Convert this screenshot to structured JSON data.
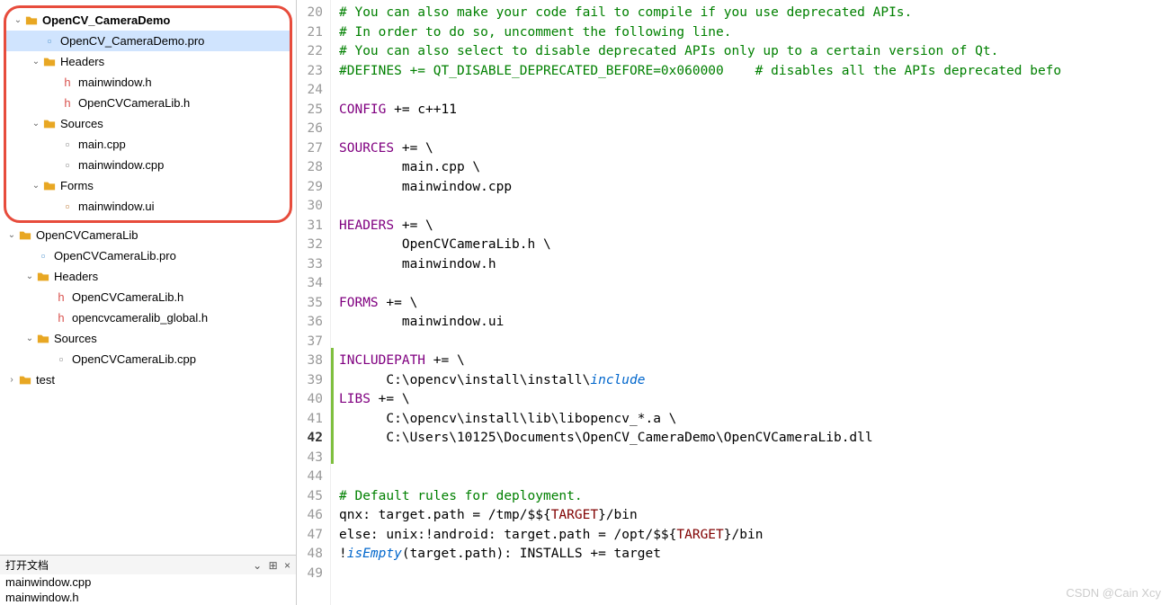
{
  "tree": {
    "project1": {
      "name": "OpenCV_CameraDemo",
      "pro": "OpenCV_CameraDemo.pro",
      "headers_label": "Headers",
      "headers": [
        "mainwindow.h",
        "OpenCVCameraLib.h"
      ],
      "sources_label": "Sources",
      "sources": [
        "main.cpp",
        "mainwindow.cpp"
      ],
      "forms_label": "Forms",
      "forms": [
        "mainwindow.ui"
      ]
    },
    "project2": {
      "name": "OpenCVCameraLib",
      "pro": "OpenCVCameraLib.pro",
      "headers_label": "Headers",
      "headers": [
        "OpenCVCameraLib.h",
        "opencvcameralib_global.h"
      ],
      "sources_label": "Sources",
      "sources": [
        "OpenCVCameraLib.cpp"
      ]
    },
    "project3": {
      "name": "test"
    }
  },
  "open_docs": {
    "title": "打开文档",
    "items": [
      "mainwindow.cpp",
      "mainwindow.h"
    ]
  },
  "editor": {
    "lines": [
      {
        "n": 20,
        "changed": false,
        "parts": [
          {
            "cls": "c-comment",
            "t": "# You can also make your code fail to compile if you use deprecated APIs."
          }
        ]
      },
      {
        "n": 21,
        "changed": false,
        "parts": [
          {
            "cls": "c-comment",
            "t": "# In order to do so, uncomment the following line."
          }
        ]
      },
      {
        "n": 22,
        "changed": false,
        "parts": [
          {
            "cls": "c-comment",
            "t": "# You can also select to disable deprecated APIs only up to a certain version of Qt."
          }
        ]
      },
      {
        "n": 23,
        "changed": false,
        "parts": [
          {
            "cls": "c-comment",
            "t": "#DEFINES += QT_DISABLE_DEPRECATED_BEFORE=0x060000    # disables all the APIs deprecated befo"
          }
        ]
      },
      {
        "n": 24,
        "changed": false,
        "parts": []
      },
      {
        "n": 25,
        "changed": false,
        "parts": [
          {
            "cls": "c-keyword",
            "t": "CONFIG"
          },
          {
            "cls": "c-plain",
            "t": " += c++11"
          }
        ]
      },
      {
        "n": 26,
        "changed": false,
        "parts": []
      },
      {
        "n": 27,
        "changed": false,
        "parts": [
          {
            "cls": "c-keyword",
            "t": "SOURCES"
          },
          {
            "cls": "c-plain",
            "t": " += \\"
          }
        ]
      },
      {
        "n": 28,
        "changed": false,
        "parts": [
          {
            "cls": "c-plain",
            "t": "        main.cpp \\"
          }
        ]
      },
      {
        "n": 29,
        "changed": false,
        "parts": [
          {
            "cls": "c-plain",
            "t": "        mainwindow.cpp"
          }
        ]
      },
      {
        "n": 30,
        "changed": false,
        "parts": []
      },
      {
        "n": 31,
        "changed": false,
        "parts": [
          {
            "cls": "c-keyword",
            "t": "HEADERS"
          },
          {
            "cls": "c-plain",
            "t": " += \\"
          }
        ]
      },
      {
        "n": 32,
        "changed": false,
        "parts": [
          {
            "cls": "c-plain",
            "t": "        OpenCVCameraLib.h \\"
          }
        ]
      },
      {
        "n": 33,
        "changed": false,
        "parts": [
          {
            "cls": "c-plain",
            "t": "        mainwindow.h"
          }
        ]
      },
      {
        "n": 34,
        "changed": false,
        "parts": []
      },
      {
        "n": 35,
        "changed": false,
        "parts": [
          {
            "cls": "c-keyword",
            "t": "FORMS"
          },
          {
            "cls": "c-plain",
            "t": " += \\"
          }
        ]
      },
      {
        "n": 36,
        "changed": false,
        "parts": [
          {
            "cls": "c-plain",
            "t": "        mainwindow.ui"
          }
        ]
      },
      {
        "n": 37,
        "changed": false,
        "parts": []
      },
      {
        "n": 38,
        "changed": true,
        "parts": [
          {
            "cls": "c-keyword",
            "t": "INCLUDEPATH"
          },
          {
            "cls": "c-plain",
            "t": " += \\"
          }
        ]
      },
      {
        "n": 39,
        "changed": true,
        "parts": [
          {
            "cls": "c-plain",
            "t": "      C:\\opencv\\install\\install\\"
          },
          {
            "cls": "c-func",
            "t": "include"
          }
        ]
      },
      {
        "n": 40,
        "changed": true,
        "parts": [
          {
            "cls": "c-keyword",
            "t": "LIBS"
          },
          {
            "cls": "c-plain",
            "t": " += \\"
          }
        ]
      },
      {
        "n": 41,
        "changed": true,
        "parts": [
          {
            "cls": "c-plain",
            "t": "      C:\\opencv\\install\\lib\\libopencv_*.a \\"
          }
        ]
      },
      {
        "n": 42,
        "changed": true,
        "current": true,
        "parts": [
          {
            "cls": "c-plain",
            "t": "      C:\\Users\\10125\\Documents\\OpenCV_CameraDemo\\OpenCVCameraLib.dll"
          }
        ]
      },
      {
        "n": 43,
        "changed": true,
        "parts": []
      },
      {
        "n": 44,
        "changed": false,
        "parts": []
      },
      {
        "n": 45,
        "changed": false,
        "parts": [
          {
            "cls": "c-comment",
            "t": "# Default rules for deployment."
          }
        ]
      },
      {
        "n": 46,
        "changed": false,
        "parts": [
          {
            "cls": "c-plain",
            "t": "qnx: target.path = /tmp/$${"
          },
          {
            "cls": "c-target",
            "t": "TARGET"
          },
          {
            "cls": "c-plain",
            "t": "}/bin"
          }
        ]
      },
      {
        "n": 47,
        "changed": false,
        "parts": [
          {
            "cls": "c-plain",
            "t": "else: unix:!android: target.path = /opt/$${"
          },
          {
            "cls": "c-target",
            "t": "TARGET"
          },
          {
            "cls": "c-plain",
            "t": "}/bin"
          }
        ]
      },
      {
        "n": 48,
        "changed": false,
        "parts": [
          {
            "cls": "c-plain",
            "t": "!"
          },
          {
            "cls": "c-func",
            "t": "isEmpty"
          },
          {
            "cls": "c-plain",
            "t": "(target.path): INSTALLS += target"
          }
        ]
      },
      {
        "n": 49,
        "changed": false,
        "parts": []
      }
    ]
  },
  "watermark": "CSDN @Cain Xcy"
}
